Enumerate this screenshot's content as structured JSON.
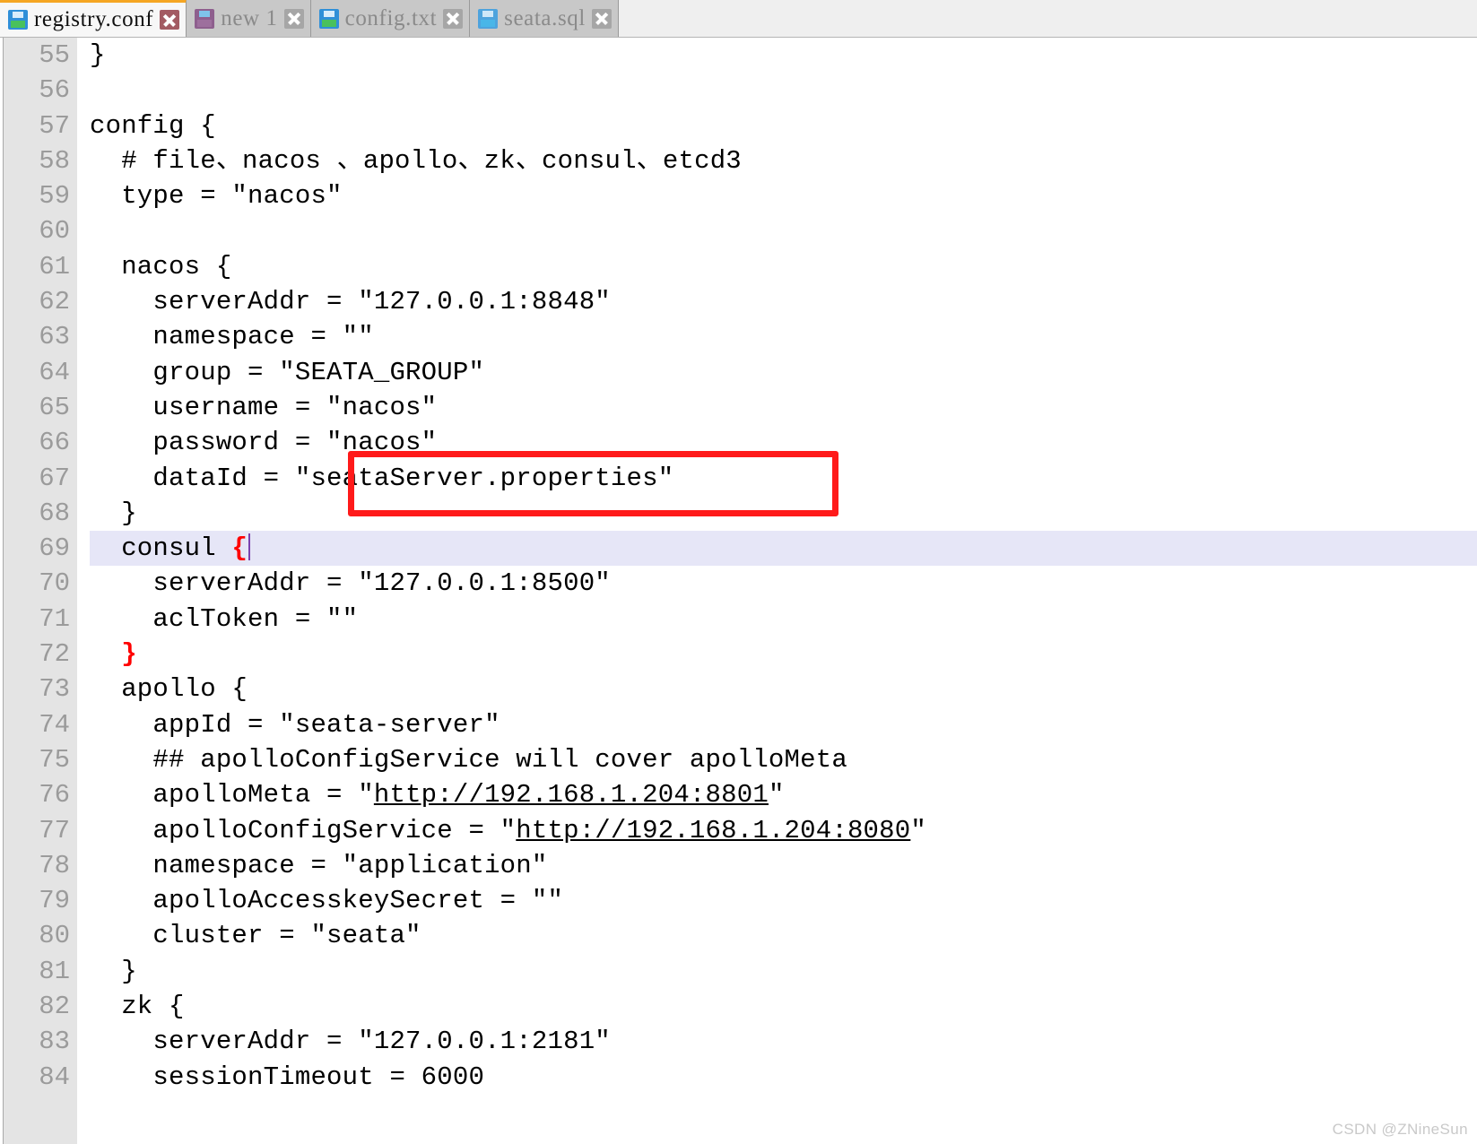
{
  "tabs": [
    {
      "label": "registry.conf",
      "icon": "floppy-disk-icon",
      "icon_color": "blue",
      "active": true,
      "close_icon": "close-icon"
    },
    {
      "label": "new 1",
      "icon": "floppy-disk-icon",
      "icon_color": "purple",
      "active": false,
      "close_icon": "close-icon"
    },
    {
      "label": "config.txt",
      "icon": "floppy-disk-icon",
      "icon_color": "blue",
      "active": false,
      "close_icon": "close-icon"
    },
    {
      "label": "seata.sql",
      "icon": "floppy-disk-icon",
      "icon_color": "blue-dim",
      "active": false,
      "close_icon": "close-icon"
    }
  ],
  "editor": {
    "first_line_number": 55,
    "current_line_number": 69,
    "lines": [
      {
        "n": "55",
        "text": "}"
      },
      {
        "n": "56",
        "text": ""
      },
      {
        "n": "57",
        "text": "config {"
      },
      {
        "n": "58",
        "text": "  # file、nacos 、apollo、zk、consul、etcd3"
      },
      {
        "n": "59",
        "text": "  type = \"nacos\""
      },
      {
        "n": "60",
        "text": ""
      },
      {
        "n": "61",
        "text": "  nacos {"
      },
      {
        "n": "62",
        "text": "    serverAddr = \"127.0.0.1:8848\""
      },
      {
        "n": "63",
        "text": "    namespace = \"\""
      },
      {
        "n": "64",
        "text": "    group = \"SEATA_GROUP\""
      },
      {
        "n": "65",
        "text": "    username = \"nacos\""
      },
      {
        "n": "66",
        "text": "    password = \"nacos\""
      },
      {
        "n": "67",
        "text": "    dataId = \"seataServer.properties\""
      },
      {
        "n": "68",
        "text": "  }"
      },
      {
        "n": "69",
        "text": "  consul ",
        "brace": "{",
        "caret": true,
        "current": true
      },
      {
        "n": "70",
        "text": "    serverAddr = \"127.0.0.1:8500\""
      },
      {
        "n": "71",
        "text": "    aclToken = \"\""
      },
      {
        "n": "72",
        "text": "  ",
        "brace": "}"
      },
      {
        "n": "73",
        "text": "  apollo {"
      },
      {
        "n": "74",
        "text": "    appId = \"seata-server\""
      },
      {
        "n": "75",
        "text": "    ## apolloConfigService will cover apolloMeta"
      },
      {
        "n": "76",
        "text": "    apolloMeta = \"",
        "link": "http://192.168.1.204:8801",
        "text_after": "\""
      },
      {
        "n": "77",
        "text": "    apolloConfigService = \"",
        "link": "http://192.168.1.204:8080",
        "text_after": "\""
      },
      {
        "n": "78",
        "text": "    namespace = \"application\""
      },
      {
        "n": "79",
        "text": "    apolloAccesskeySecret = \"\""
      },
      {
        "n": "80",
        "text": "    cluster = \"seata\""
      },
      {
        "n": "81",
        "text": "  }"
      },
      {
        "n": "82",
        "text": "  zk {"
      },
      {
        "n": "83",
        "text": "    serverAddr = \"127.0.0.1:2181\""
      },
      {
        "n": "84",
        "text": "    sessionTimeout = 6000"
      }
    ]
  },
  "annotation": {
    "type": "red-rectangle-highlight",
    "target_text": "\"seataServer.properties\"",
    "color": "#ff1a1a"
  },
  "watermark": {
    "text": "CSDN @ZNineSun"
  },
  "colors": {
    "active_tab_accent": "#f5a623",
    "current_line_highlight": "#e6e6f7",
    "brace_match": "#ff0000",
    "gutter_bg": "#e4e4e4",
    "caret": "#7a42b0"
  }
}
